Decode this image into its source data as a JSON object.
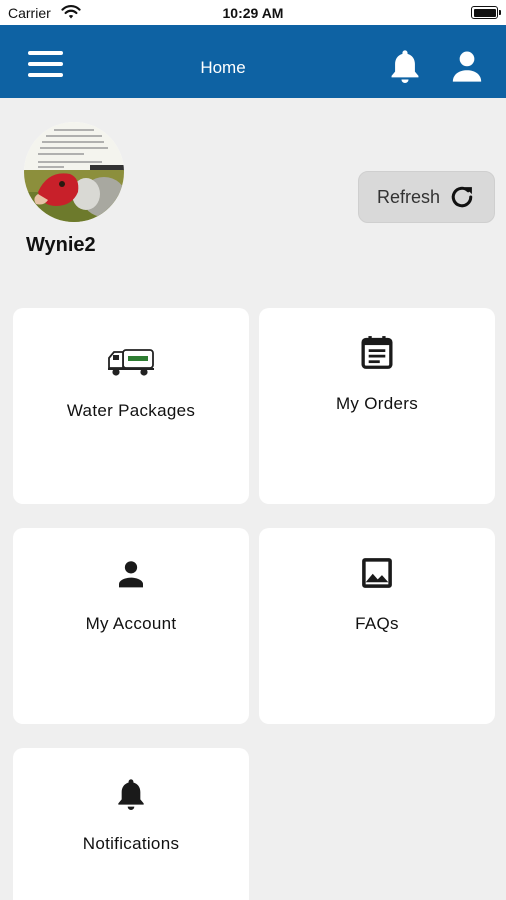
{
  "status_bar": {
    "carrier": "Carrier",
    "time": "10:29 AM"
  },
  "header": {
    "title": "Home"
  },
  "profile": {
    "username": "Wynie2"
  },
  "refresh": {
    "label": "Refresh"
  },
  "tiles": [
    {
      "label": "Water Packages",
      "icon": "water-truck-icon"
    },
    {
      "label": "My Orders",
      "icon": "calendar-icon"
    },
    {
      "label": "My Account",
      "icon": "person-icon"
    },
    {
      "label": "FAQs",
      "icon": "image-icon"
    },
    {
      "label": "Notifications",
      "icon": "bell-icon"
    }
  ],
  "colors": {
    "header": "#0e62a3",
    "background": "#efefef",
    "tile": "#ffffff",
    "refresh_button": "#d9d9d9"
  }
}
